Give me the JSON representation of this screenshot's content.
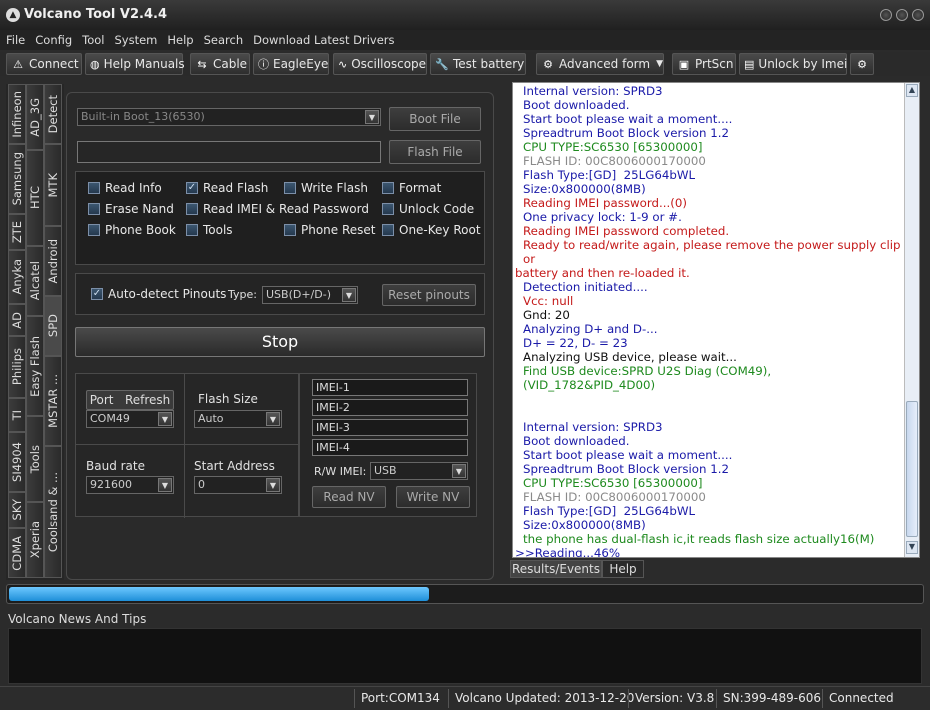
{
  "window": {
    "title": "Volcano Tool V2.4.4"
  },
  "menu": [
    "File",
    "Config",
    "Tool",
    "System",
    "Help",
    "Search",
    "Download Latest Drivers"
  ],
  "toolbar": {
    "connect": "Connect",
    "help_manuals": "Help Manuals",
    "cable": "Cable",
    "eagleeye": "EagleEye",
    "oscilloscope": "Oscilloscope",
    "test_battery": "Test battery",
    "advanced_form": "Advanced form",
    "prtscn": "PrtScn",
    "unlock_by_imei": "Unlock by Imei"
  },
  "left_tabs": {
    "col1": [
      "Infineon",
      "Samsung",
      "ZTE",
      "Anyka",
      "AD",
      "Philips",
      "TI",
      "SI4904",
      "SKY",
      "CDMA"
    ],
    "col2": [
      "AD_3G",
      "HTC",
      "Alcatel",
      "Easy Flash",
      "Tools",
      "Xperia"
    ],
    "col3": [
      "Detect",
      "MTK",
      "Android",
      "SPD",
      "MSTAR ...",
      "Coolsand & ..."
    ]
  },
  "boot": {
    "select_value": "Built-in Boot_13(6530)",
    "boot_file_button": "Boot File",
    "flash_file_value": "",
    "flash_file_button": "Flash File"
  },
  "options": [
    {
      "label": "Read Info",
      "checked": false
    },
    {
      "label": "Read Flash",
      "checked": true
    },
    {
      "label": "Write Flash",
      "checked": false
    },
    {
      "label": "Format",
      "checked": false
    },
    {
      "label": "Erase Nand",
      "checked": false
    },
    {
      "label": "Read IMEI & Read Password",
      "checked": false
    },
    {
      "label": "Unlock Code",
      "checked": false
    },
    {
      "label": "Phone Book",
      "checked": false
    },
    {
      "label": "Tools",
      "checked": false
    },
    {
      "label": "Phone Reset",
      "checked": false
    },
    {
      "label": "One-Key Root",
      "checked": false
    }
  ],
  "pinouts": {
    "auto_detect_label": "Auto-detect Pinouts",
    "auto_detect_checked": true,
    "type_label": "Type:",
    "type_value": "USB(D+/D-)",
    "reset_button": "Reset pinouts"
  },
  "stop_button": "Stop",
  "port": {
    "port_label": "Port",
    "refresh_label": "Refresh",
    "port_value": "COM49",
    "flash_size_label": "Flash Size",
    "flash_size_value": "Auto",
    "baud_label": "Baud rate",
    "baud_value": "921600",
    "start_address_label": "Start Address",
    "start_address_value": "0"
  },
  "imei": {
    "fields": [
      "IMEI-1",
      "IMEI-2",
      "IMEI-3",
      "IMEI-4"
    ],
    "rw_label": "R/W IMEI:",
    "rw_value": "USB",
    "read_nv": "Read NV",
    "write_nv": "Write NV"
  },
  "colors": {
    "blue": "#1a1aa8",
    "green": "#1e8a1e",
    "gray": "#8a8a8a",
    "red": "#c41a1a",
    "black": "#101010"
  },
  "log": [
    {
      "text": "Internal version: SPRD3",
      "color": "blue",
      "indent": true
    },
    {
      "text": "Boot downloaded.",
      "color": "blue",
      "indent": true
    },
    {
      "text": "Start boot please wait a moment....",
      "color": "blue",
      "indent": true
    },
    {
      "text": "Spreadtrum Boot Block version 1.2",
      "color": "blue",
      "indent": true
    },
    {
      "text": "CPU TYPE:SC6530 [65300000]",
      "color": "green",
      "indent": true
    },
    {
      "text": "FLASH ID: 00C8006000170000",
      "color": "gray",
      "indent": true
    },
    {
      "text": "Flash Type:[GD]  25LG64bWL",
      "color": "blue",
      "indent": true
    },
    {
      "text": "Size:0x800000(8MB)",
      "color": "blue",
      "indent": true
    },
    {
      "text": "Reading IMEI password...(0)",
      "color": "red",
      "indent": true
    },
    {
      "text": "One privacy lock: 1-9 or #.",
      "color": "blue",
      "indent": true
    },
    {
      "text": "Reading IMEI password completed.",
      "color": "red",
      "indent": true
    },
    {
      "text": "Ready to read/write again, please remove the power supply clip or",
      "color": "red",
      "indent": true
    },
    {
      "text": "battery and then re-loaded it.",
      "color": "red",
      "indent": false
    },
    {
      "text": "Detection initiated....",
      "color": "blue",
      "indent": true
    },
    {
      "text": "Vcc: null",
      "color": "red",
      "indent": true
    },
    {
      "text": "Gnd: 20",
      "color": "black",
      "indent": true
    },
    {
      "text": "Analyzing D+ and D-...",
      "color": "blue",
      "indent": true
    },
    {
      "text": "D+ = 22, D- = 23",
      "color": "blue",
      "indent": true
    },
    {
      "text": "Analyzing USB device, please wait...",
      "color": "black",
      "indent": true
    },
    {
      "text": "Find USB device:SPRD U2S Diag (COM49), (VID_1782&PID_4D00)",
      "color": "green",
      "indent": true
    },
    {
      "text": "",
      "color": "black",
      "indent": true
    },
    {
      "text": "",
      "color": "black",
      "indent": true
    },
    {
      "text": "Internal version: SPRD3",
      "color": "blue",
      "indent": true
    },
    {
      "text": "Boot downloaded.",
      "color": "blue",
      "indent": true
    },
    {
      "text": "Start boot please wait a moment....",
      "color": "blue",
      "indent": true
    },
    {
      "text": "Spreadtrum Boot Block version 1.2",
      "color": "blue",
      "indent": true
    },
    {
      "text": "CPU TYPE:SC6530 [65300000]",
      "color": "green",
      "indent": true
    },
    {
      "text": "FLASH ID: 00C8006000170000",
      "color": "gray",
      "indent": true
    },
    {
      "text": "Flash Type:[GD]  25LG64bWL",
      "color": "blue",
      "indent": true
    },
    {
      "text": "Size:0x800000(8MB)",
      "color": "blue",
      "indent": true
    },
    {
      "text": "the phone has dual-flash ic,it reads flash size actually16(M)",
      "color": "green",
      "indent": true
    },
    {
      "text": ">>Reading...46%",
      "color": "blue",
      "indent": false
    }
  ],
  "log_tabs": {
    "results": "Results/Events",
    "help": "Help"
  },
  "progress": 0.46,
  "news": {
    "label": "Volcano News And Tips"
  },
  "status": {
    "port": "Port:COM134",
    "updated": "Volcano Updated: 2013-12-20",
    "version": "Version: V3.8",
    "sn": "SN:399-489-606",
    "connection": "Connected"
  }
}
